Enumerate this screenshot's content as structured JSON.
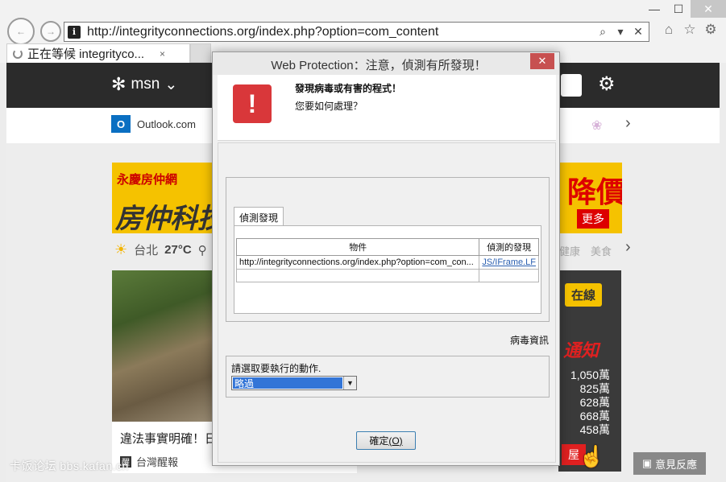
{
  "browser": {
    "url": "http://integrityconnections.org/index.php?option=com_content",
    "tab_title": "正在等候 integrityco...",
    "tab_close": "×",
    "search_icon": "⌕",
    "dropdown_icon": "▾",
    "stop_icon": "✕"
  },
  "msn": {
    "logo_text": "msn",
    "outlook_label": "Outlook.com",
    "weather_city": "台北",
    "weather_temp": "27°C",
    "weather_right": "健康　美食",
    "ad_left_top": "永慶房仲網",
    "ad_left_big": "房仲科技",
    "ad_right_big": "降價",
    "ad_right_more": "更多",
    "news_title": "違法事實明確！日人",
    "news_source": "台灣醒報",
    "side_online": "在線",
    "side_notify": "通知",
    "side_prices": [
      "1,050萬",
      "825萬",
      "628萬",
      "668萬",
      "458萬"
    ],
    "side_house": "屋",
    "feedback": "意見反應"
  },
  "dialog": {
    "title": "Web Protection：注意，偵測有所發現！",
    "close": "✕",
    "heading": "發現病毒或有害的程式！",
    "subheading": "您要如何處理？",
    "tab_label": "偵測發現",
    "columns": [
      "物件",
      "偵測的發現"
    ],
    "rows": [
      {
        "object": "http://integrityconnections.org/index.php?option=com_con...",
        "finding": "JS/IFrame.LF"
      }
    ],
    "virus_info": "病毒資訊",
    "action_label": "請選取要執行的動作.",
    "action_value": "略過",
    "ok_label": "確定",
    "ok_shortcut": "(O)"
  },
  "watermark": "卡饭论坛 bbs.kafan.cn"
}
